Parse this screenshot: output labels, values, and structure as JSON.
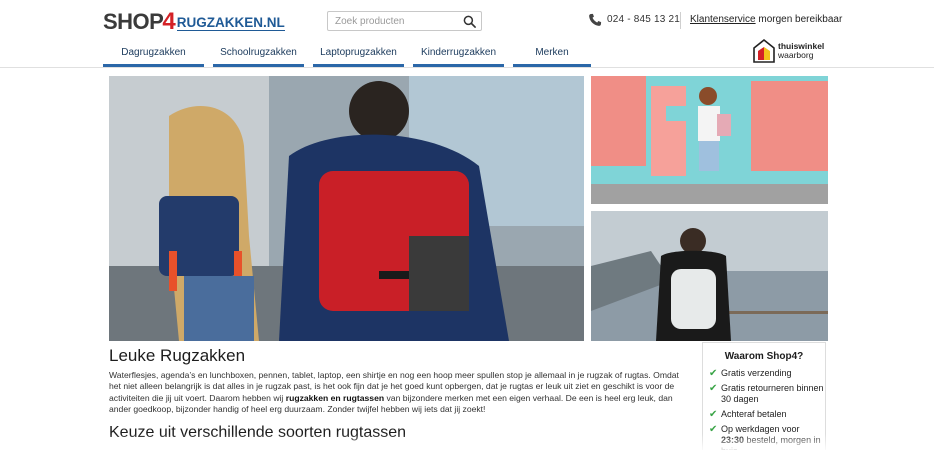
{
  "logo": {
    "shop": "SHOP",
    "four": "4",
    "domain": "RUGZAKKEN.NL"
  },
  "search": {
    "placeholder": "Zoek producten",
    "value": ""
  },
  "contact": {
    "phone": "024 - 845 13 21",
    "service_link": "Klantenservice",
    "service_text": " morgen bereikbaar"
  },
  "nav": {
    "items": [
      {
        "label": "Dagrugzakken"
      },
      {
        "label": "Schoolrugzakken"
      },
      {
        "label": "Laptoprugzakken"
      },
      {
        "label": "Kinderrugzakken"
      },
      {
        "label": "Merken"
      }
    ]
  },
  "badge": {
    "line1": "thuiswinkel",
    "line2": "waarborg"
  },
  "content": {
    "title": "Leuke Rugzakken",
    "p1_a": "Waterflesjes, agenda’s en lunchboxen, pennen, tablet, laptop, een shirtje en nog een hoop meer spullen stop je allemaal in je rugzak of rugtas. Omdat het niet alleen belangrijk is dat alles in je rugzak past, is het ook fijn dat je het goed kunt opbergen, dat je rugtas er leuk uit ziet en geschikt is voor de activiteiten die jij uit voert. Daarom hebben wij ",
    "p1_bold": "rugzakken en rugtassen",
    "p1_b": " van bijzondere merken met een eigen verhaal. De een is heel erg leuk, dan ander goedkoop, bijzonder handig of heel erg duurzaam. Zonder twijfel hebben wij iets dat jij zoekt!",
    "subtitle": "Keuze uit verschillende soorten rugtassen"
  },
  "why": {
    "title": "Waarom Shop4?",
    "items": [
      {
        "text": "Gratis verzending"
      },
      {
        "text": "Gratis retourneren binnen 30 dagen"
      },
      {
        "text": "Achteraf betalen"
      },
      {
        "text_a": "Op werkdagen voor ",
        "text_bold": "23:30",
        "text_b": " besteld, morgen in huis"
      }
    ]
  },
  "colors": {
    "brand_red": "#d42126",
    "brand_blue": "#1f5a96",
    "nav_accent": "#2b67a8",
    "check_green": "#3aa447"
  },
  "icons": {
    "search": "search-icon",
    "phone": "phone-icon",
    "check": "check-icon",
    "badge": "thuiswinkel-logo-icon"
  }
}
